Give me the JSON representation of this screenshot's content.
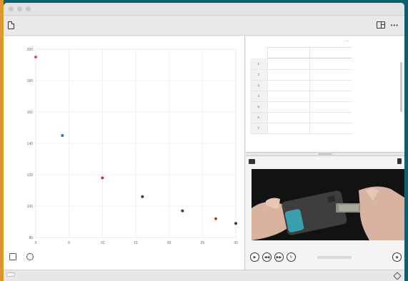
{
  "window": {
    "title": ""
  },
  "toolbar": {
    "file_name": "",
    "layout_icon": "layout-icon",
    "menu_icon": "ellipsis-icon"
  },
  "graph": {
    "y_label": "",
    "x_label": "",
    "tools": [
      "graph-settings-icon",
      "zoom-icon"
    ]
  },
  "chart_data": {
    "type": "scatter",
    "xlim": [
      0,
      30
    ],
    "ylim": [
      80,
      200
    ],
    "xticks": [
      0,
      5,
      10,
      15,
      20,
      25,
      30
    ],
    "yticks": [
      80,
      100,
      120,
      140,
      160,
      180,
      200
    ],
    "x": [
      0,
      4,
      10,
      16,
      22,
      27,
      30
    ],
    "y": [
      195,
      145,
      118,
      106,
      97,
      92,
      89
    ],
    "grid": true,
    "colors": [
      "#d9534f",
      "#3b6fb6",
      "#c0392b",
      "#2c3e50",
      "#2c3e50",
      "#c0392b",
      "#2c3e50"
    ]
  },
  "table": {
    "dataset_title": "",
    "col1_header": "",
    "col2_header": "",
    "rows": [
      {
        "n": "1",
        "a": "",
        "b": ""
      },
      {
        "n": "2",
        "a": "",
        "b": ""
      },
      {
        "n": "3",
        "a": "",
        "b": ""
      },
      {
        "n": "4",
        "a": "",
        "b": ""
      },
      {
        "n": "5",
        "a": "",
        "b": ""
      },
      {
        "n": "6",
        "a": "",
        "b": ""
      },
      {
        "n": "7",
        "a": "",
        "b": ""
      }
    ]
  },
  "video": {
    "time": "",
    "controls": [
      "play-icon",
      "skip-back-icon",
      "skip-forward-icon",
      "loop-icon"
    ]
  },
  "status": {
    "button_label": ""
  },
  "colors": {
    "accent": "#0f5e6e",
    "side": "#d79a2a"
  }
}
